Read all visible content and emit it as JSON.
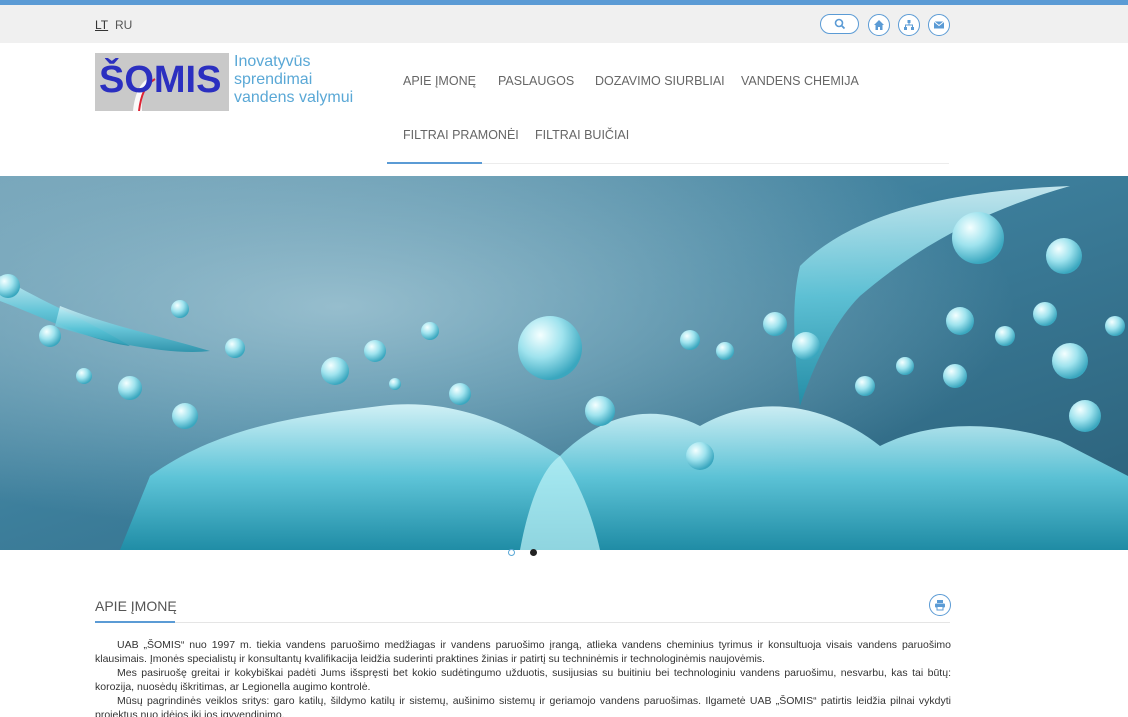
{
  "languages": {
    "lt": "LT",
    "ru": "RU"
  },
  "logo": {
    "text": "ŠOMIS"
  },
  "tagline": [
    "Inovatyvūs",
    "sprendimai",
    "vandens valymui"
  ],
  "nav": [
    "APIE ĮMONĘ",
    "PASLAUGOS",
    "DOZAVIMO SIURBLIAI",
    "VANDENS CHEMIJA",
    "FILTRAI PRAMONĖI",
    "FILTRAI BUIČIAI"
  ],
  "top_icons": [
    "search-icon",
    "home-icon",
    "sitemap-icon",
    "mail-icon"
  ],
  "colors": {
    "accent": "#5b9bd5",
    "tagline": "#5aa8d6",
    "logo": "#2b2fc0"
  },
  "slider": {
    "slides": 2,
    "active": 2
  },
  "section": {
    "title": "APIE ĮMONĘ",
    "paragraphs": [
      "UAB „ŠOMIS“ nuo 1997 m. tiekia vandens paruošimo medžiagas ir vandens paruošimo įrangą, atlieka vandens cheminius tyrimus ir konsultuoja visais vandens paruošimo klausimais. Įmonės specialistų ir konsultantų kvalifikacija leidžia suderinti praktines žinias ir patirtį su techninėmis ir technologinėmis naujovėmis.",
      "Mes pasiruošę greitai ir kokybiškai padėti Jums išspręsti bet kokio sudėtingumo užduotis, susijusias su buitiniu bei technologiniu vandens paruošimu, nesvarbu, kas tai būtų: korozija, nuosėdų iškritimas, ar Legionella augimo kontrolė.",
      "Mūsų pagrindinės veiklos sritys: garo katilų, šildymo katilų ir sistemų, aušinimo sistemų ir geriamojo vandens paruošimas. Ilgametė UAB „ŠOMIS“ patirtis leidžia pilnai vykdyti projektus nuo idėjos iki jos įgyvendinimo."
    ]
  }
}
